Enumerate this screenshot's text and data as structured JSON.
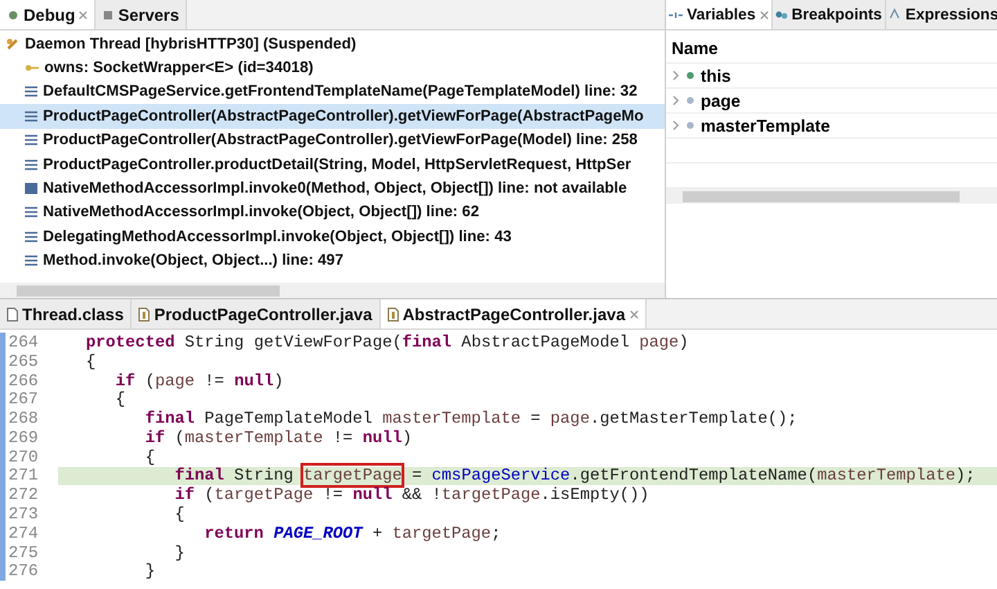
{
  "debug_panel": {
    "tabs": [
      {
        "label": "Debug",
        "selected": true
      },
      {
        "label": "Servers",
        "selected": false
      }
    ],
    "frames": [
      {
        "kind": "thread",
        "text": "Daemon Thread [hybrisHTTP30] (Suspended)",
        "selected": false,
        "children": [
          {
            "kind": "monitor",
            "text": "owns: SocketWrapper<E>  (id=34018)",
            "selected": false
          },
          {
            "kind": "frame",
            "text": "DefaultCMSPageService.getFrontendTemplateName(PageTemplateModel) line: 32",
            "selected": false
          },
          {
            "kind": "frame",
            "text": "ProductPageController(AbstractPageController).getViewForPage(AbstractPageMo",
            "selected": true
          },
          {
            "kind": "frame",
            "text": "ProductPageController(AbstractPageController).getViewForPage(Model) line: 258",
            "selected": false
          },
          {
            "kind": "frame",
            "text": "ProductPageController.productDetail(String, Model, HttpServletRequest, HttpSer",
            "selected": false
          },
          {
            "kind": "native",
            "text": "NativeMethodAccessorImpl.invoke0(Method, Object, Object[]) line: not available",
            "selected": false
          },
          {
            "kind": "frame",
            "text": "NativeMethodAccessorImpl.invoke(Object, Object[]) line: 62",
            "selected": false
          },
          {
            "kind": "frame",
            "text": "DelegatingMethodAccessorImpl.invoke(Object, Object[]) line: 43",
            "selected": false
          },
          {
            "kind": "frame",
            "text": "Method.invoke(Object, Object...) line: 497",
            "selected": false
          }
        ]
      }
    ]
  },
  "variables_panel": {
    "tabs": [
      {
        "label": "Variables",
        "selected": true
      },
      {
        "label": "Breakpoints",
        "selected": false
      },
      {
        "label": "Expressions",
        "selected": false
      }
    ],
    "column": "Name",
    "variables": [
      {
        "name": "this",
        "expanded": false,
        "color": "#4f9a6f"
      },
      {
        "name": "page",
        "expanded": false,
        "color": "#a8b8c8"
      },
      {
        "name": "masterTemplate",
        "expanded": false,
        "color": "#a8b8c8"
      }
    ]
  },
  "editor": {
    "tabs": [
      {
        "label": "Thread.class",
        "selected": false
      },
      {
        "label": "ProductPageController.java",
        "selected": false
      },
      {
        "label": "AbstractPageController.java",
        "selected": true
      }
    ],
    "lines": [
      {
        "number": "264",
        "current": false,
        "tokens": [
          {
            "kind": "keyword",
            "text": "protected"
          },
          {
            "kind": "plain",
            "text": " String getViewForPage("
          },
          {
            "kind": "keyword",
            "text": "final"
          },
          {
            "kind": "plain",
            "text": " AbstractPageModel "
          },
          {
            "kind": "variable",
            "text": "page"
          },
          {
            "kind": "plain",
            "text": ")"
          }
        ]
      },
      {
        "number": "265",
        "current": false,
        "tokens": [
          {
            "kind": "plain",
            "text": "{"
          }
        ],
        "children": [
          {
            "number": "266",
            "current": false,
            "tokens": [
              {
                "kind": "keyword",
                "text": "if"
              },
              {
                "kind": "plain",
                "text": " ("
              },
              {
                "kind": "variable",
                "text": "page"
              },
              {
                "kind": "plain",
                "text": " != "
              },
              {
                "kind": "keyword",
                "text": "null"
              },
              {
                "kind": "plain",
                "text": ")"
              }
            ]
          },
          {
            "number": "267",
            "current": false,
            "tokens": [
              {
                "kind": "plain",
                "text": "{"
              }
            ],
            "children": [
              {
                "number": "268",
                "current": false,
                "tokens": [
                  {
                    "kind": "keyword",
                    "text": "final"
                  },
                  {
                    "kind": "plain",
                    "text": " PageTemplateModel "
                  },
                  {
                    "kind": "variable",
                    "text": "masterTemplate"
                  },
                  {
                    "kind": "plain",
                    "text": " = "
                  },
                  {
                    "kind": "variable",
                    "text": "page"
                  },
                  {
                    "kind": "plain",
                    "text": ".getMasterTemplate();"
                  }
                ]
              },
              {
                "number": "269",
                "current": false,
                "tokens": [
                  {
                    "kind": "keyword",
                    "text": "if"
                  },
                  {
                    "kind": "plain",
                    "text": " ("
                  },
                  {
                    "kind": "variable",
                    "text": "masterTemplate"
                  },
                  {
                    "kind": "plain",
                    "text": " != "
                  },
                  {
                    "kind": "keyword",
                    "text": "null"
                  },
                  {
                    "kind": "plain",
                    "text": ")"
                  }
                ]
              },
              {
                "number": "270",
                "current": false,
                "tokens": [
                  {
                    "kind": "plain",
                    "text": "{"
                  }
                ],
                "children": [
                  {
                    "number": "271",
                    "current": true,
                    "tokens": [
                      {
                        "kind": "keyword",
                        "text": "final"
                      },
                      {
                        "kind": "plain",
                        "text": " String "
                      },
                      {
                        "kind": "boxed",
                        "text": "targetPage"
                      },
                      {
                        "kind": "plain",
                        "text": " = "
                      },
                      {
                        "kind": "field",
                        "text": "cmsPageService"
                      },
                      {
                        "kind": "plain",
                        "text": ".getFrontendTemplateName("
                      },
                      {
                        "kind": "variable",
                        "text": "masterTemplate"
                      },
                      {
                        "kind": "plain",
                        "text": ");"
                      }
                    ]
                  },
                  {
                    "number": "272",
                    "current": false,
                    "tokens": [
                      {
                        "kind": "keyword",
                        "text": "if"
                      },
                      {
                        "kind": "plain",
                        "text": " ("
                      },
                      {
                        "kind": "variable",
                        "text": "targetPage"
                      },
                      {
                        "kind": "plain",
                        "text": " != "
                      },
                      {
                        "kind": "keyword",
                        "text": "null"
                      },
                      {
                        "kind": "plain",
                        "text": " && !"
                      },
                      {
                        "kind": "variable",
                        "text": "targetPage"
                      },
                      {
                        "kind": "plain",
                        "text": ".isEmpty())"
                      }
                    ]
                  },
                  {
                    "number": "273",
                    "current": false,
                    "tokens": [
                      {
                        "kind": "plain",
                        "text": "{"
                      }
                    ],
                    "children": [
                      {
                        "number": "274",
                        "current": false,
                        "tokens": [
                          {
                            "kind": "keyword",
                            "text": "return"
                          },
                          {
                            "kind": "constant",
                            "text": "PAGE_ROOT"
                          },
                          {
                            "kind": "plain",
                            "text": "+"
                          },
                          {
                            "kind": "variable",
                            "text": "targetPage"
                          },
                          {
                            "kind": "plain",
                            "text": ";"
                          }
                        ]
                      }
                    ]
                  },
                  {
                    "number": "275",
                    "current": false,
                    "tokens": [
                      {
                        "kind": "plain",
                        "text": "}"
                      }
                    ]
                  }
                ]
              },
              {
                "number": "276",
                "current": false,
                "tokens": [
                  {
                    "kind": "plain",
                    "text": "}"
                  }
                ]
              }
            ]
          }
        ]
      }
    ]
  }
}
